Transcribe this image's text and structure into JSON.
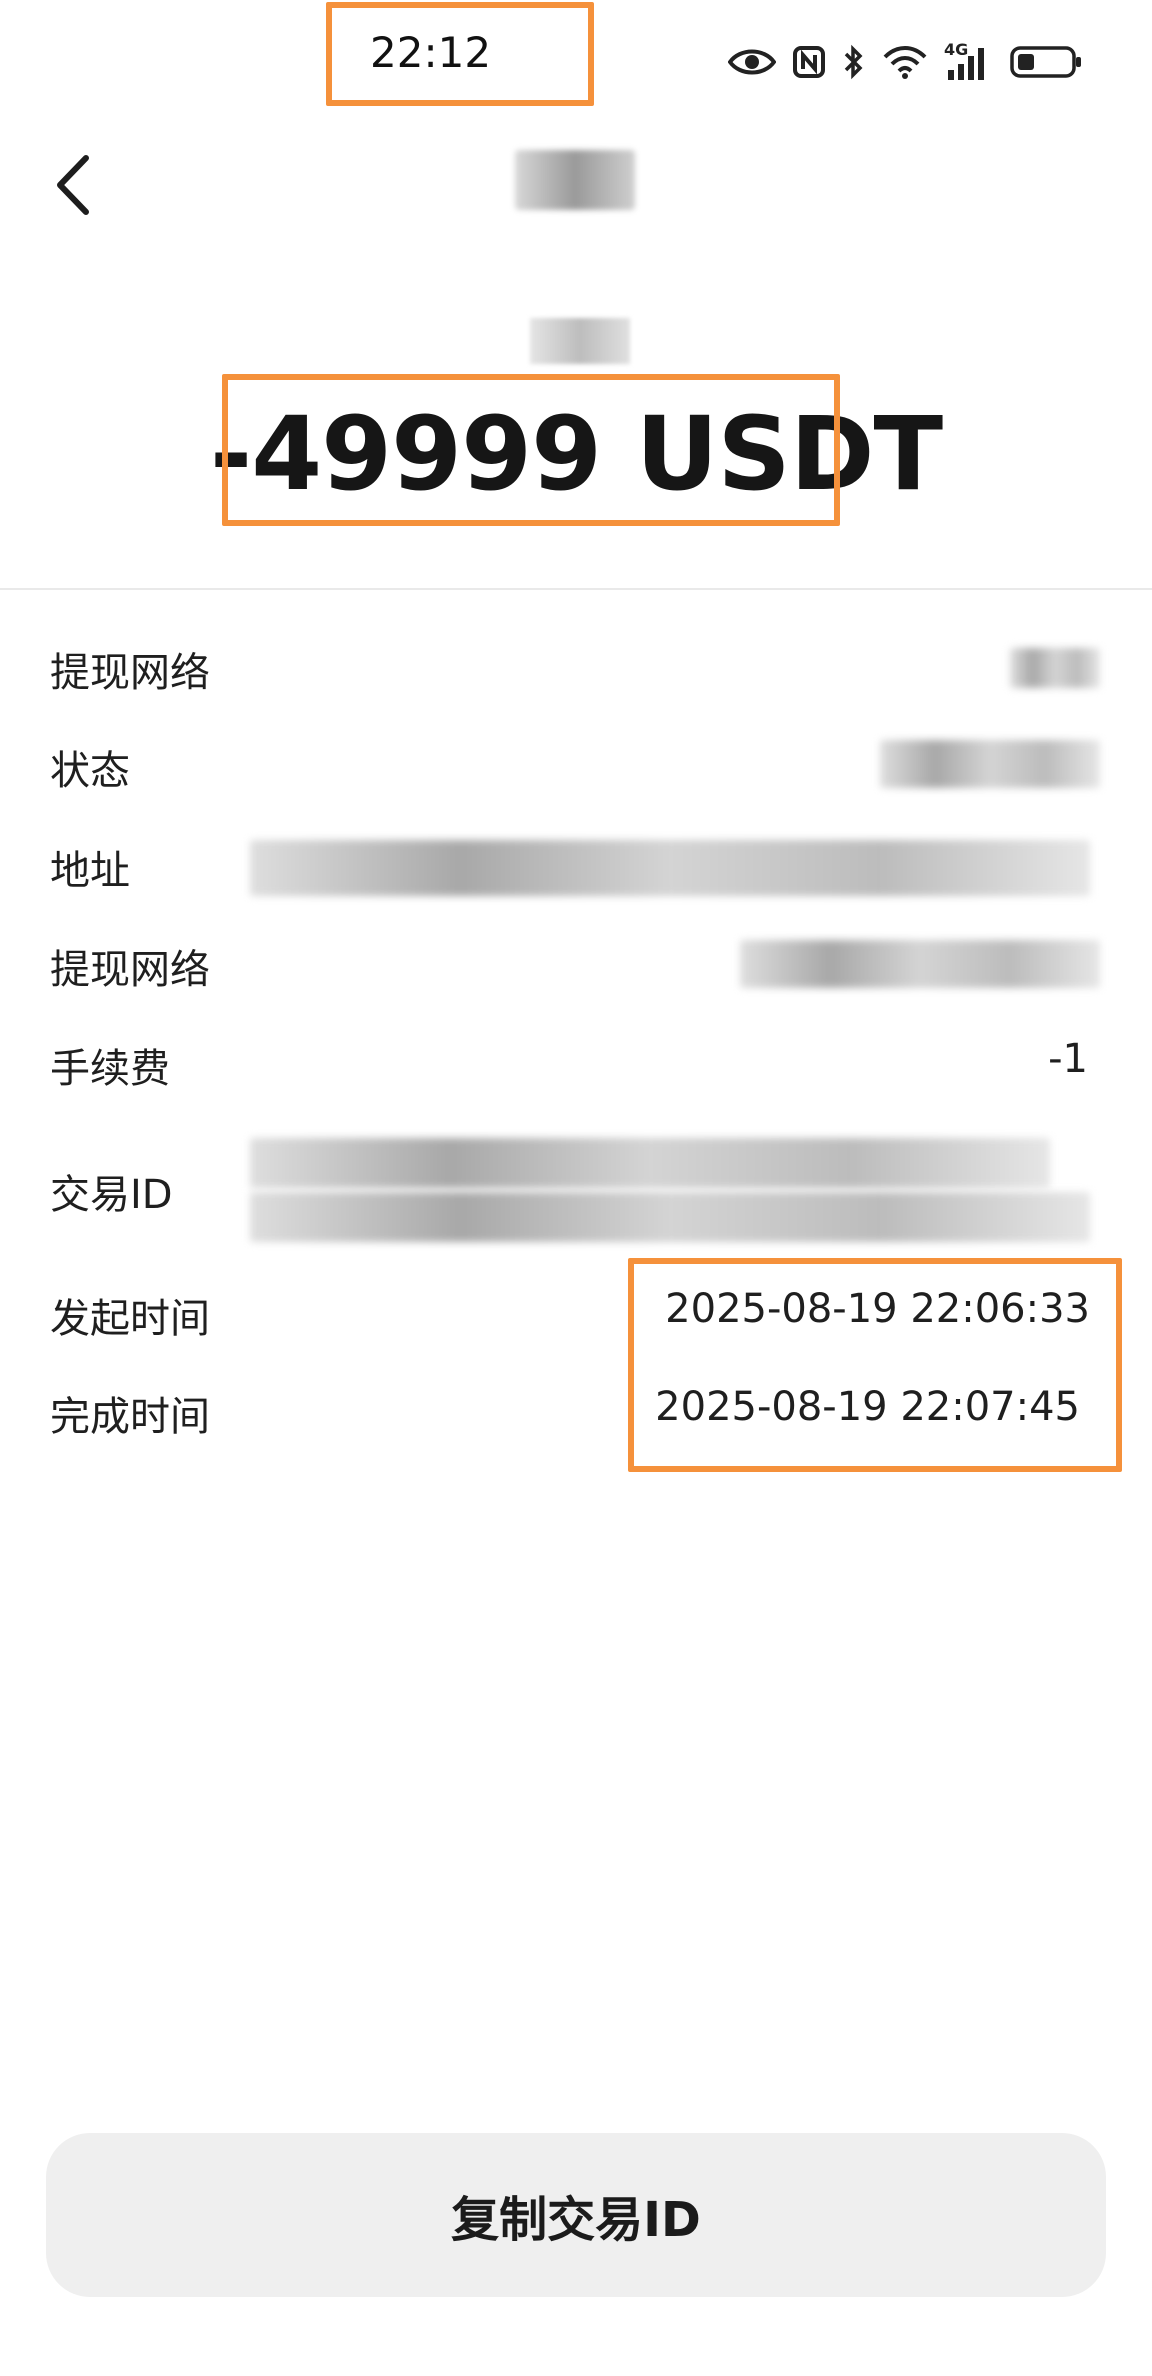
{
  "status_bar": {
    "time": "22:12",
    "icons": [
      "eye-icon",
      "nfc-icon",
      "bluetooth-icon",
      "wifi-icon",
      "signal-4g-icon",
      "battery-icon"
    ],
    "network_label": "4G"
  },
  "header": {
    "back_icon": "chevron-left-icon"
  },
  "summary": {
    "amount": "-49999 USDT"
  },
  "details": {
    "network_label": "提现网络",
    "status_label": "状态",
    "address_label": "地址",
    "network2_label": "提现网络",
    "fee_label": "手续费",
    "fee_value": "-1",
    "txid_label": "交易ID",
    "start_time_label": "发起时间",
    "start_time_value": "2025-08-19 22:06:33",
    "complete_time_label": "完成时间",
    "complete_time_value": "2025-08-19 22:07:45"
  },
  "actions": {
    "copy_txid_label": "复制交易ID"
  },
  "colors": {
    "highlight": "#f5913b",
    "button_bg": "#efefef"
  }
}
